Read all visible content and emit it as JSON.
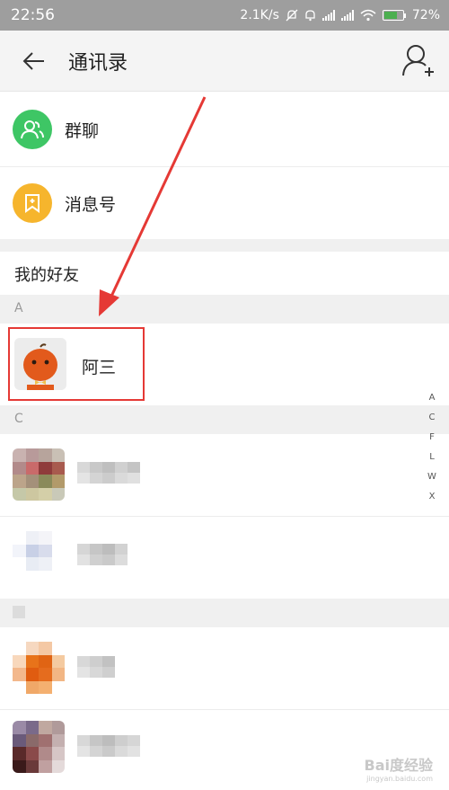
{
  "status_bar": {
    "time": "22:56",
    "speed": "2.1K/s",
    "battery": "72%"
  },
  "header": {
    "title": "通讯录"
  },
  "menu": [
    {
      "label": "群聊",
      "color": "#3ec665"
    },
    {
      "label": "消息号",
      "color": "#f6b52d"
    }
  ],
  "friends": {
    "heading": "我的好友",
    "sections": [
      {
        "letter": "A",
        "contacts": [
          {
            "name": "阿三"
          }
        ]
      },
      {
        "letter": "C"
      }
    ]
  },
  "index_letters": [
    "A",
    "C",
    "F",
    "L",
    "W",
    "X"
  ],
  "annotation_color": "#e53935",
  "watermark": {
    "brand": "Bai度经验",
    "url": "jingyan.baidu.com"
  }
}
